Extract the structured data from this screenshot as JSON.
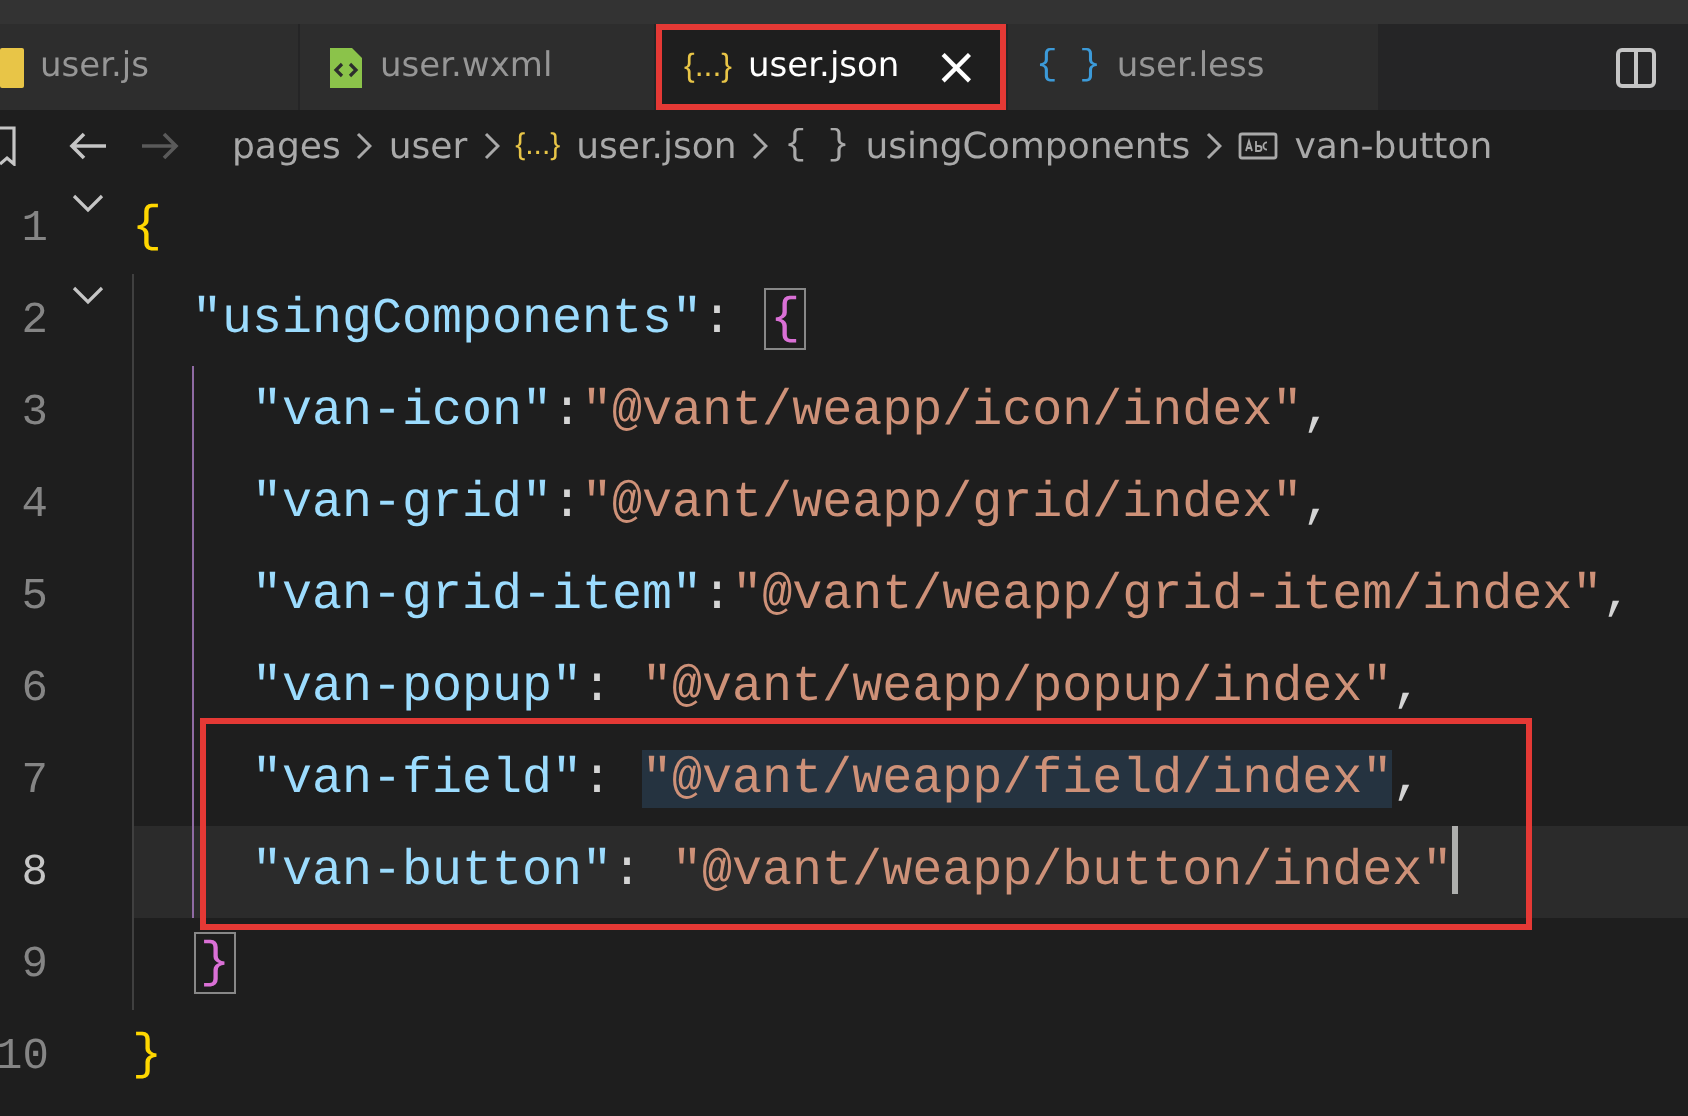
{
  "tabs": [
    {
      "label": "user.js",
      "kind": "js",
      "selected": false,
      "outlined": false
    },
    {
      "label": "user.wxml",
      "kind": "wxml",
      "selected": false,
      "outlined": false
    },
    {
      "label": "user.json",
      "kind": "json",
      "glyph": "{...}",
      "selected": true,
      "outlined": true,
      "close": "×"
    },
    {
      "label": "user.less",
      "kind": "less",
      "glyph": "{ }",
      "selected": false,
      "outlined": false
    }
  ],
  "breadcrumb": {
    "back_enabled": true,
    "forward_enabled": false,
    "items": [
      {
        "kind": "folder",
        "text": "pages"
      },
      {
        "kind": "folder",
        "text": "user"
      },
      {
        "kind": "file",
        "glyph": "{...}",
        "text": "user.json"
      },
      {
        "kind": "object",
        "glyph": "{ }",
        "text": "usingComponents"
      },
      {
        "kind": "string",
        "text": "van-button"
      }
    ]
  },
  "lines": [
    {
      "number": "1",
      "foldable": true,
      "current": false,
      "outlined": false,
      "tokens": [
        {
          "kind": "bracket1",
          "text": "{"
        }
      ],
      "children": [
        {
          "number": "2",
          "foldable": true,
          "current": false,
          "outlined": false,
          "tokens": [
            {
              "kind": "key",
              "text": "\"usingComponents\""
            },
            {
              "kind": "punct",
              "text": ": "
            },
            {
              "kind": "bracket2",
              "text": "{",
              "matched": true
            }
          ],
          "children": [
            {
              "number": "3",
              "foldable": false,
              "current": false,
              "outlined": false,
              "tokens": [
                {
                  "kind": "key",
                  "text": "\"van-icon\""
                },
                {
                  "kind": "punct",
                  "text": ":"
                },
                {
                  "kind": "string",
                  "text": "\"@vant/weapp/icon/index\""
                },
                {
                  "kind": "punct",
                  "text": ","
                }
              ]
            },
            {
              "number": "4",
              "foldable": false,
              "current": false,
              "outlined": false,
              "tokens": [
                {
                  "kind": "key",
                  "text": "\"van-grid\""
                },
                {
                  "kind": "punct",
                  "text": ":"
                },
                {
                  "kind": "string",
                  "text": "\"@vant/weapp/grid/index\""
                },
                {
                  "kind": "punct",
                  "text": ","
                }
              ]
            },
            {
              "number": "5",
              "foldable": false,
              "current": false,
              "outlined": false,
              "tokens": [
                {
                  "kind": "key",
                  "text": "\"van-grid-item\""
                },
                {
                  "kind": "punct",
                  "text": ":"
                },
                {
                  "kind": "string",
                  "text": "\"@vant/weapp/grid-item/index\""
                },
                {
                  "kind": "punct",
                  "text": ","
                }
              ]
            },
            {
              "number": "6",
              "foldable": false,
              "current": false,
              "outlined": false,
              "tokens": [
                {
                  "kind": "key",
                  "text": "\"van-popup\""
                },
                {
                  "kind": "punct",
                  "text": ": "
                },
                {
                  "kind": "string",
                  "text": "\"@vant/weapp/popup/index\""
                },
                {
                  "kind": "punct",
                  "text": ","
                }
              ]
            },
            {
              "number": "7",
              "foldable": false,
              "current": false,
              "outlined": true,
              "tokens": [
                {
                  "kind": "key",
                  "text": "\"van-field\""
                },
                {
                  "kind": "punct",
                  "text": ": "
                },
                {
                  "kind": "string",
                  "text": "\"@vant/weapp/field/index\"",
                  "highlighted": true
                },
                {
                  "kind": "punct",
                  "text": ","
                }
              ]
            },
            {
              "number": "8",
              "foldable": false,
              "current": true,
              "outlined": true,
              "tokens": [
                {
                  "kind": "key",
                  "text": "\"van-button\""
                },
                {
                  "kind": "punct",
                  "text": ": "
                },
                {
                  "kind": "string",
                  "text": "\"@vant/weapp/button/index\""
                }
              ]
            }
          ]
        },
        {
          "number": "9",
          "foldable": false,
          "current": false,
          "outlined": false,
          "tokens": [
            {
              "kind": "bracket2",
              "text": "}",
              "matched": true
            }
          ]
        }
      ]
    },
    {
      "number": "10",
      "foldable": false,
      "current": false,
      "outlined": false,
      "tokens": [
        {
          "kind": "bracket1",
          "text": "}"
        }
      ]
    }
  ]
}
